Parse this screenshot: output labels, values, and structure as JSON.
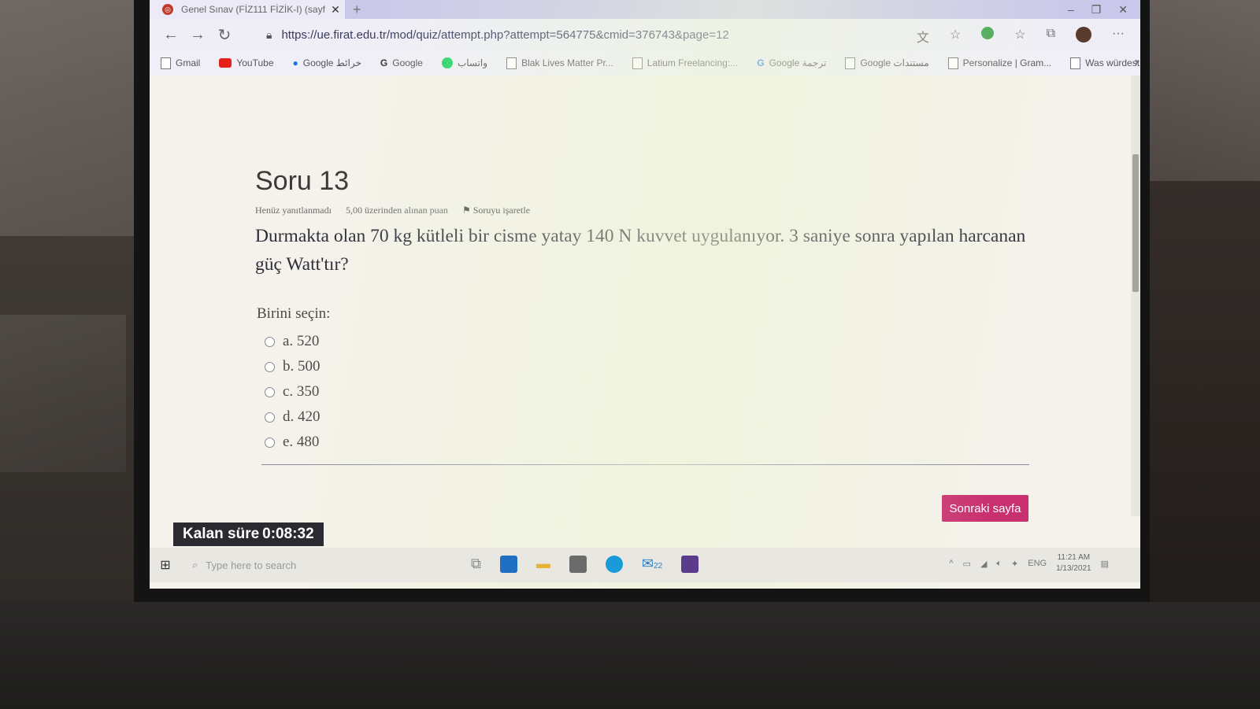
{
  "browser": {
    "tab_title": "Genel Sınav (FİZ111 FİZİK-I) (sayf",
    "new_tab": "+",
    "url": "https://ue.firat.edu.tr/mod/quiz/attempt.php?attempt=564775&cmid=376743&page=12"
  },
  "bookmarks": [
    {
      "label": "Gmail",
      "icon": "page-icon"
    },
    {
      "label": "YouTube",
      "icon": "youtube-icon"
    },
    {
      "label": "Google خرائط",
      "icon": "maps-icon"
    },
    {
      "label": "Google",
      "icon": "google-icon"
    },
    {
      "label": "واتساب",
      "icon": "whatsapp-icon"
    },
    {
      "label": "Blak Lives Matter Pr...",
      "icon": "page-icon"
    },
    {
      "label": "Latium Freelancing:...",
      "icon": "page-icon"
    },
    {
      "label": "Google ترجمة",
      "icon": "translate-icon"
    },
    {
      "label": "Google مستندات",
      "icon": "page-icon"
    },
    {
      "label": "Personalize | Gram...",
      "icon": "page-icon"
    },
    {
      "label": "Was würdest du ge...",
      "icon": "page-icon"
    }
  ],
  "question": {
    "title": "Soru 13",
    "status": "Henüz yanıtlanmadı",
    "points": "5,00 üzerinden alınan puan",
    "flag_label": "Soruyu işaretle",
    "text": "Durmakta olan 70 kg kütleli bir cisme yatay 140 N kuvvet uygulanıyor. 3 saniye sonra yapılan harcanan güç Watt'tır?",
    "prompt": "Birini seçin:",
    "options": [
      "a. 520",
      "b. 500",
      "c. 350",
      "d. 420",
      "e. 480"
    ]
  },
  "next_button": "Sonraki sayfa",
  "timer": {
    "label": "Kalan süre",
    "value": "0:08:32"
  },
  "taskbar": {
    "search_placeholder": "Type here to search",
    "language": "ENG",
    "time": "11:21 AM",
    "date": "1/13/2021",
    "mail_badge": "22"
  },
  "colors": {
    "accent_button": "#c9306f",
    "timer_bg": "#2a2a30"
  }
}
